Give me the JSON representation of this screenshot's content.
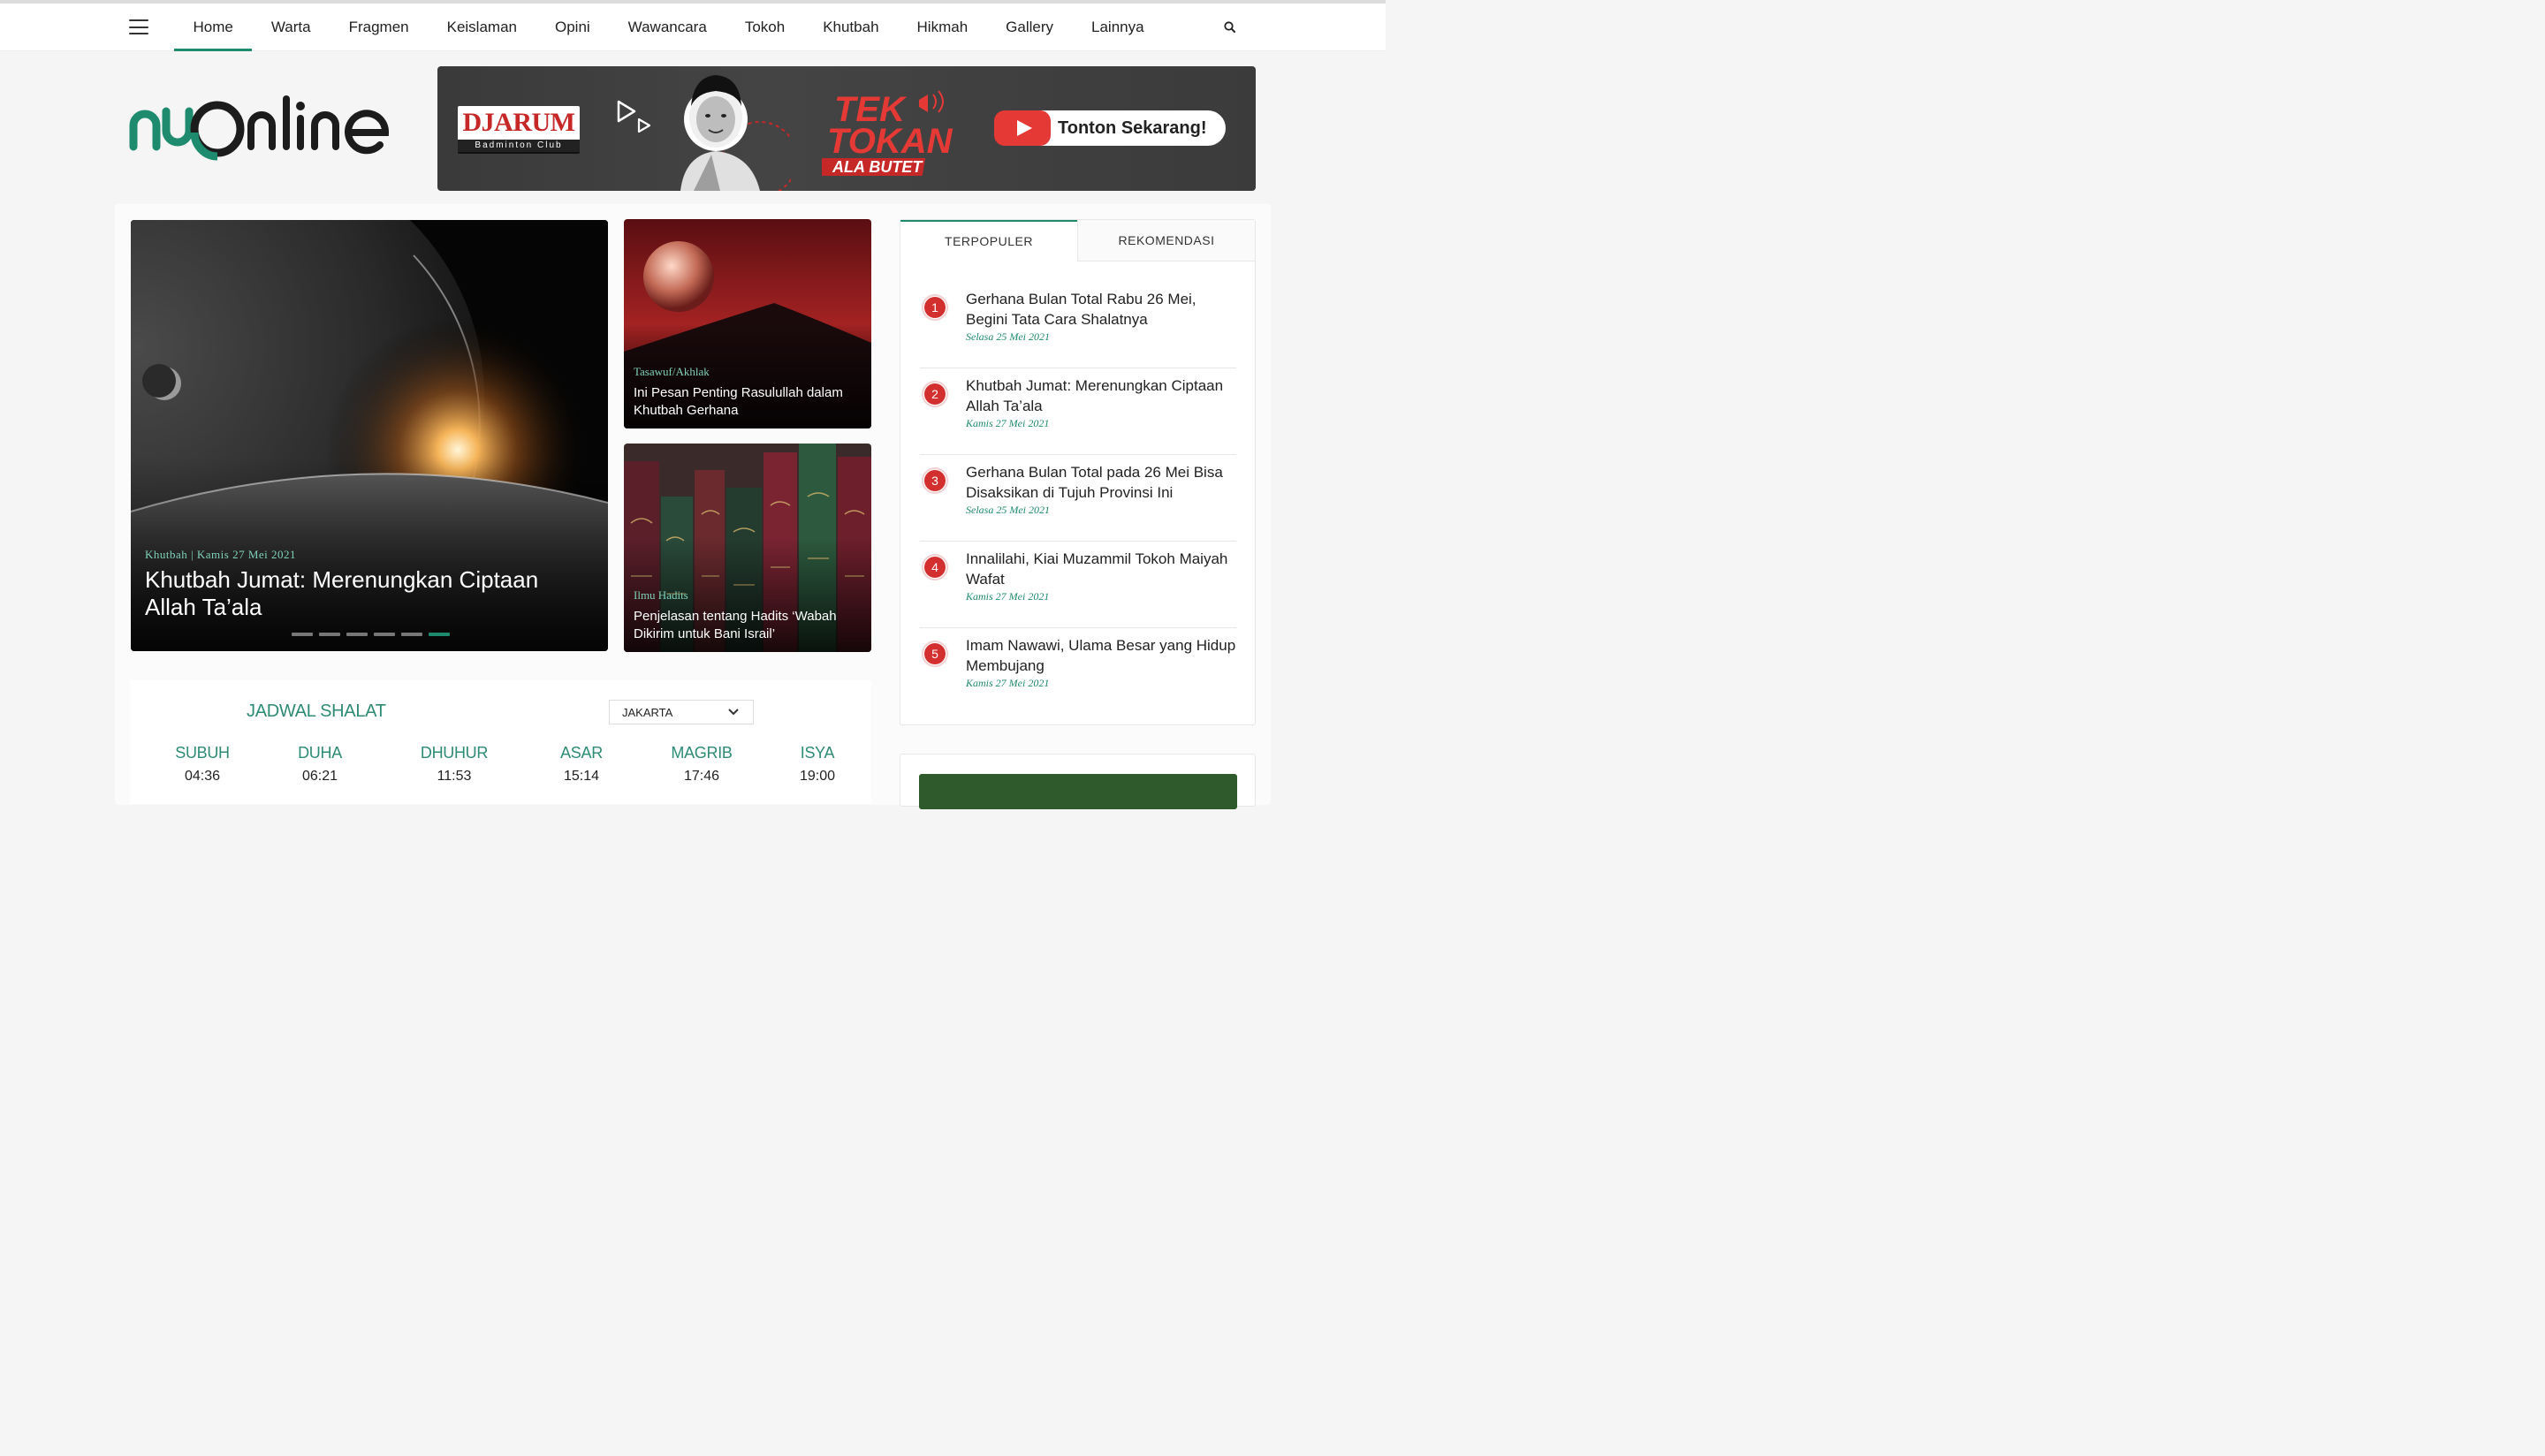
{
  "nav": {
    "items": [
      "Home",
      "Warta",
      "Fragmen",
      "Keislaman",
      "Opini",
      "Wawancara",
      "Tokoh",
      "Khutbah",
      "Hikmah",
      "Gallery",
      "Lainnya"
    ],
    "active": "Home"
  },
  "logo": {
    "text": "nuonline"
  },
  "banner": {
    "brand": "DJARUM",
    "brand_sub": "Badminton Club",
    "campaign_line1": "TEK",
    "campaign_line2": "TOKAN",
    "campaign_line3": "ALA BUTET",
    "cta": "Tonton Sekarang!"
  },
  "hero": {
    "category": "Khutbah",
    "separator": "|",
    "date": "Kamis 27 Mei 2021",
    "title": "Khutbah Jumat: Merenungkan Ciptaan Allah Ta’ala",
    "slides": 6,
    "active_slide": 6
  },
  "side_articles": [
    {
      "category": "Tasawuf/Akhlak",
      "title": "Ini Pesan Penting Rasulullah dalam Khutbah Gerhana"
    },
    {
      "category": "Ilmu Hadits",
      "title": "Penjelasan tentang Hadits ‘Wabah Dikirim untuk Bani Israil’"
    }
  ],
  "tabs": {
    "popular": "TERPOPULER",
    "recommended": "REKOMENDASI",
    "active": "TERPOPULER"
  },
  "popular": [
    {
      "rank": "1",
      "title": "Gerhana Bulan Total Rabu 26 Mei, Begini Tata Cara Shalatnya",
      "date": "Selasa 25 Mei 2021"
    },
    {
      "rank": "2",
      "title": "Khutbah Jumat: Merenungkan Ciptaan Allah Ta’ala",
      "date": "Kamis 27 Mei 2021"
    },
    {
      "rank": "3",
      "title": "Gerhana Bulan Total pada 26 Mei Bisa Disaksikan di Tujuh Provinsi Ini",
      "date": "Selasa 25 Mei 2021"
    },
    {
      "rank": "4",
      "title": "Innalilahi, Kiai Muzammil Tokoh Maiyah Wafat",
      "date": "Kamis 27 Mei 2021"
    },
    {
      "rank": "5",
      "title": "Imam Nawawi, Ulama Besar yang Hidup Membujang",
      "date": "Kamis 27 Mei 2021"
    }
  ],
  "prayer": {
    "title": "JADWAL SHALAT",
    "city": "JAKARTA",
    "times": [
      {
        "name": "SUBUH",
        "time": "04:36"
      },
      {
        "name": "DUHA",
        "time": "06:21"
      },
      {
        "name": "DHUHUR",
        "time": "11:53"
      },
      {
        "name": "ASAR",
        "time": "15:14"
      },
      {
        "name": "MAGRIB",
        "time": "17:46"
      },
      {
        "name": "ISYA",
        "time": "19:00"
      }
    ]
  },
  "colors": {
    "accent": "#1e8a6e",
    "rank_badge": "#d32f2f",
    "prayer_label": "#2e8b75"
  },
  "icons": [
    "hamburger-menu-icon",
    "search-icon",
    "play-icon",
    "youtube-icon",
    "chevron-down-icon"
  ]
}
